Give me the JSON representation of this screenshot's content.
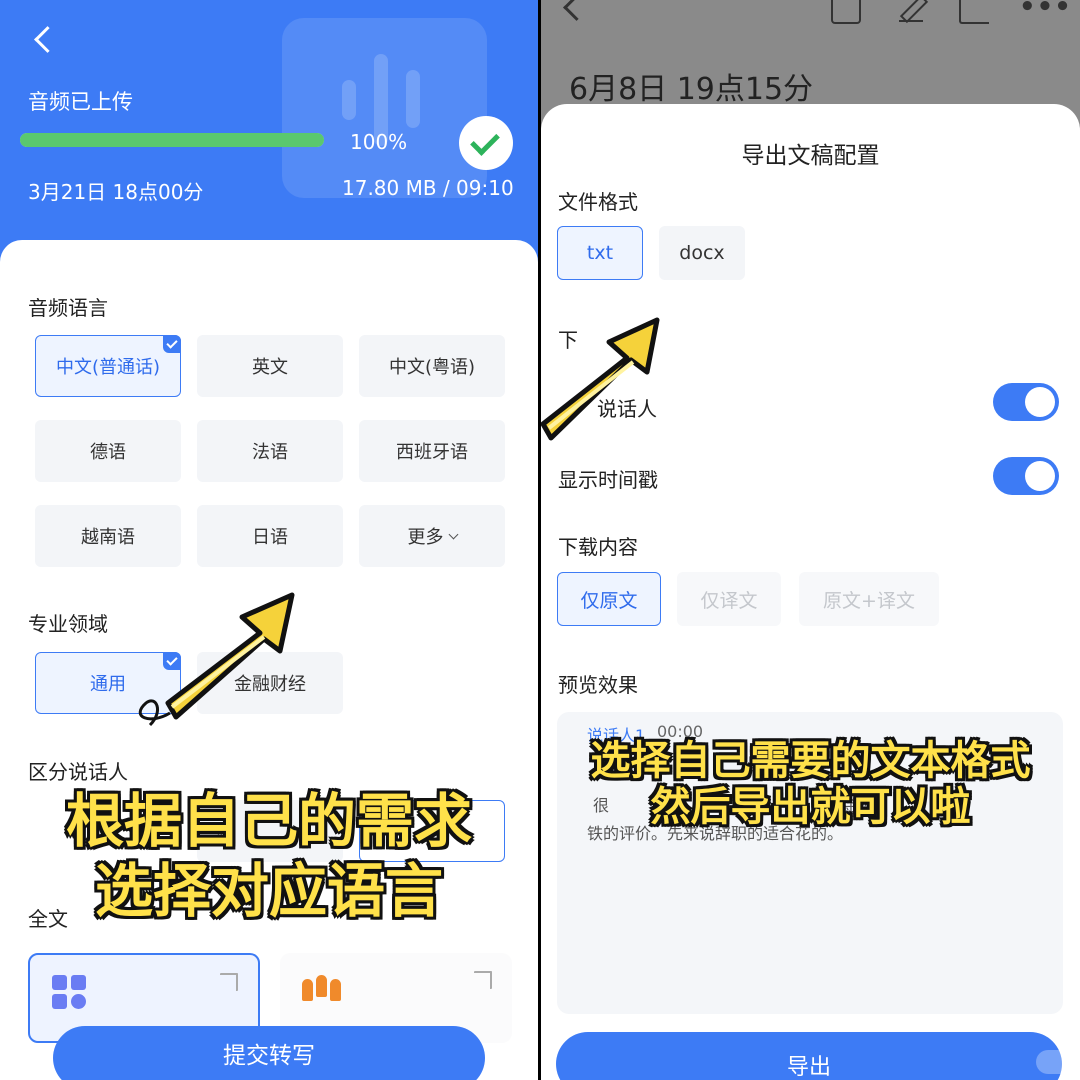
{
  "left": {
    "header": {
      "upload_status": "音频已上传",
      "progress": {
        "value": 100,
        "label": "100%"
      },
      "date": "3月21日 18点00分",
      "size_duration": "17.80 MB /  09:10"
    },
    "audio_language": {
      "title": "音频语言",
      "options": [
        "中文(普通话)",
        "英文",
        "中文(粤语)",
        "德语",
        "法语",
        "西班牙语",
        "越南语",
        "日语",
        "更多"
      ],
      "selected": "中文(普通话)"
    },
    "domain": {
      "title": "专业领域",
      "options": [
        "通用",
        "金融财经"
      ],
      "selected": "通用"
    },
    "speaker": {
      "title": "区分说话人",
      "partial_option": "两"
    },
    "full_text_title": "全文",
    "submit_label": "提交转写",
    "caption": [
      "根据自己的需求",
      "选择对应语言"
    ]
  },
  "right": {
    "record_title": "6月8日 19点15分",
    "sheet_title": "导出文稿配置",
    "file_format": {
      "title": "文件格式",
      "options": [
        "txt",
        "docx"
      ],
      "selected": "txt"
    },
    "download_settings_partial": "下",
    "toggles": [
      {
        "label": "说话人",
        "on": true
      },
      {
        "label": "显示时间戳",
        "on": true
      }
    ],
    "download_content": {
      "title": "下载内容",
      "options": [
        "仅原文",
        "仅译文",
        "原文+译文"
      ],
      "selected": "仅原文"
    },
    "preview": {
      "title": "预览效果",
      "speaker": "说话人1",
      "time": "00:00",
      "text_line1": "很                                              金如",
      "text_line2": "铁的评价。先来说辞职的适合花的。"
    },
    "export_label": "导出",
    "caption": [
      "选择自己需要的文本格式",
      "然后导出就可以啦"
    ]
  },
  "colors": {
    "accent": "#3d7bf5",
    "progress": "#5ac86e",
    "caption": "#ffe14a",
    "arrow": "#f5d23a"
  }
}
